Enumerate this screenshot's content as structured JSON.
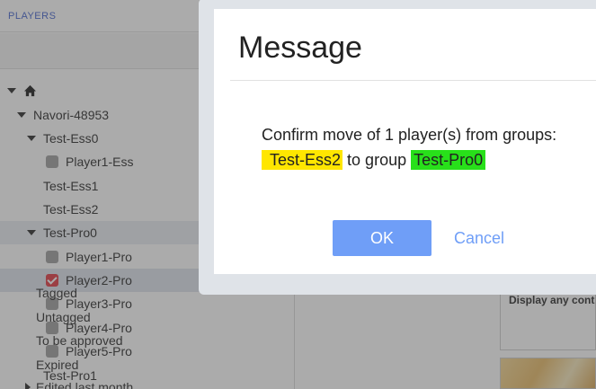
{
  "sidebar": {
    "header": "PLAYERS",
    "tree": [
      {
        "label": "",
        "icon": "home-icon",
        "type": "root"
      },
      {
        "label": "Navori-48953",
        "type": "group"
      },
      {
        "label": "Test-Ess0",
        "type": "group"
      },
      {
        "label": "Player1-Ess",
        "type": "player",
        "checked": false
      },
      {
        "label": "Test-Ess1",
        "type": "group"
      },
      {
        "label": "Test-Ess2",
        "type": "group"
      },
      {
        "label": "Test-Pro0",
        "type": "group"
      },
      {
        "label": "Player1-Pro",
        "type": "player",
        "checked": false
      },
      {
        "label": "Player2-Pro",
        "type": "player",
        "checked": true
      },
      {
        "label": "Player3-Pro",
        "type": "player",
        "checked": false
      },
      {
        "label": "Player4-Pro",
        "type": "player",
        "checked": false
      },
      {
        "label": "Player5-Pro",
        "type": "player",
        "checked": false
      },
      {
        "label": "Test-Pro1",
        "type": "group"
      }
    ]
  },
  "main": {
    "filters": [
      "Tagged",
      "Untagged",
      "To be approved",
      "Expired",
      "Edited last month"
    ],
    "card_text": "Display any cont"
  },
  "modal": {
    "title": "Message",
    "body_prefix": "Confirm move of 1 player(s) from groups:",
    "source_group": "Test-Ess2",
    "body_middle": "to group",
    "target_group": "Test-Pro0",
    "ok_label": "OK",
    "cancel_label": "Cancel"
  },
  "colors": {
    "accent": "#6f9ef7",
    "source_highlight": "#ffe600",
    "target_highlight": "#28e01a",
    "checked": "#e0303a"
  }
}
